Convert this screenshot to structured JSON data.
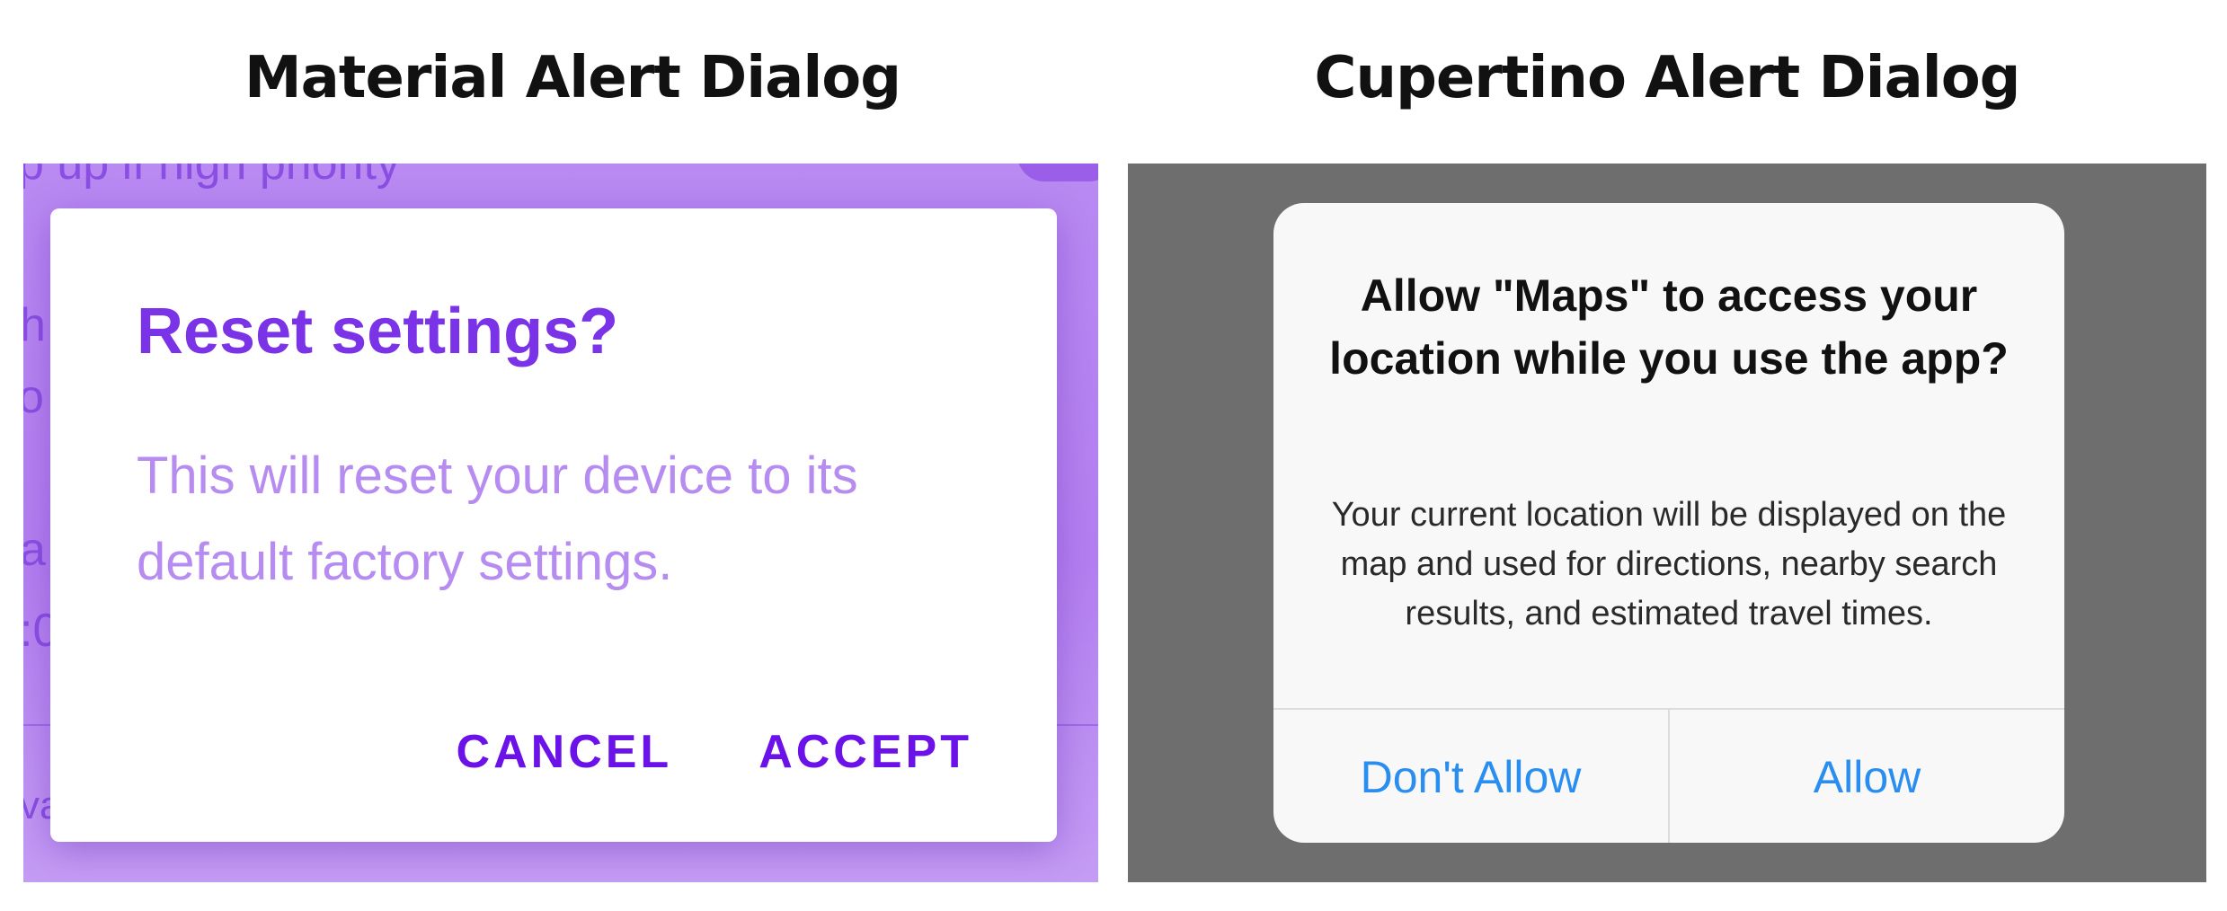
{
  "captions": {
    "material": "Material Alert Dialog",
    "cupertino": "Cupertino Alert Dialog"
  },
  "material": {
    "background_fragments": {
      "top": "p up if high priority",
      "h": "h",
      "o": "o",
      "a": "a",
      "c": ":0",
      "v": "va"
    },
    "dialog": {
      "title": "Reset settings?",
      "body": "This will reset your device to its default factory settings.",
      "cancel_label": "CANCEL",
      "accept_label": "ACCEPT"
    },
    "colors": {
      "accent": "#7a33e6",
      "button": "#6a12e8",
      "body_text": "#b68cf0",
      "scrim": "#b37ff0"
    }
  },
  "cupertino": {
    "dialog": {
      "title": "Allow \"Maps\" to access your location while you use the app?",
      "message": "Your current location will be displayed on the map and used for directions, nearby search results, and estimated travel times.",
      "dont_allow_label": "Don't Allow",
      "allow_label": "Allow"
    },
    "colors": {
      "action": "#2a8ef0",
      "backdrop": "#6e6e6e",
      "dialog_bg": "#f8f8f8"
    }
  }
}
